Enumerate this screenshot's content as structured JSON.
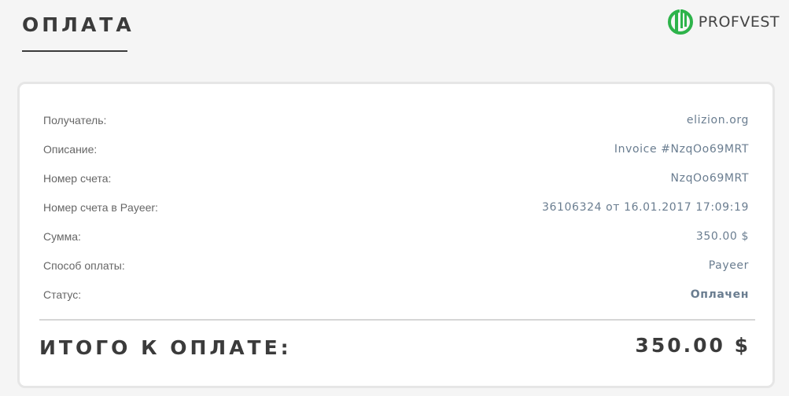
{
  "header": {
    "title": "ОПЛАТА",
    "brand_name": "PROFVEST",
    "brand_icon": "profvest-logo-icon",
    "accent_color": "#2db34a"
  },
  "payment": {
    "rows": [
      {
        "label": "Получатель:",
        "value": "elizion.org"
      },
      {
        "label": "Описание:",
        "value": "Invoice #NzqOo69MRT"
      },
      {
        "label": "Номер счета:",
        "value": "NzqOo69MRT"
      },
      {
        "label": "Номер счета в Payeer:",
        "value": "36106324 от 16.01.2017 17:09:19"
      },
      {
        "label": "Сумма:",
        "value": "350.00 $"
      },
      {
        "label": "Способ оплаты:",
        "value": "Payeer"
      },
      {
        "label": "Статус:",
        "value": "Оплачен"
      }
    ],
    "total_label": "ИТОГО К ОПЛАТЕ:",
    "total_value": "350.00 $"
  }
}
